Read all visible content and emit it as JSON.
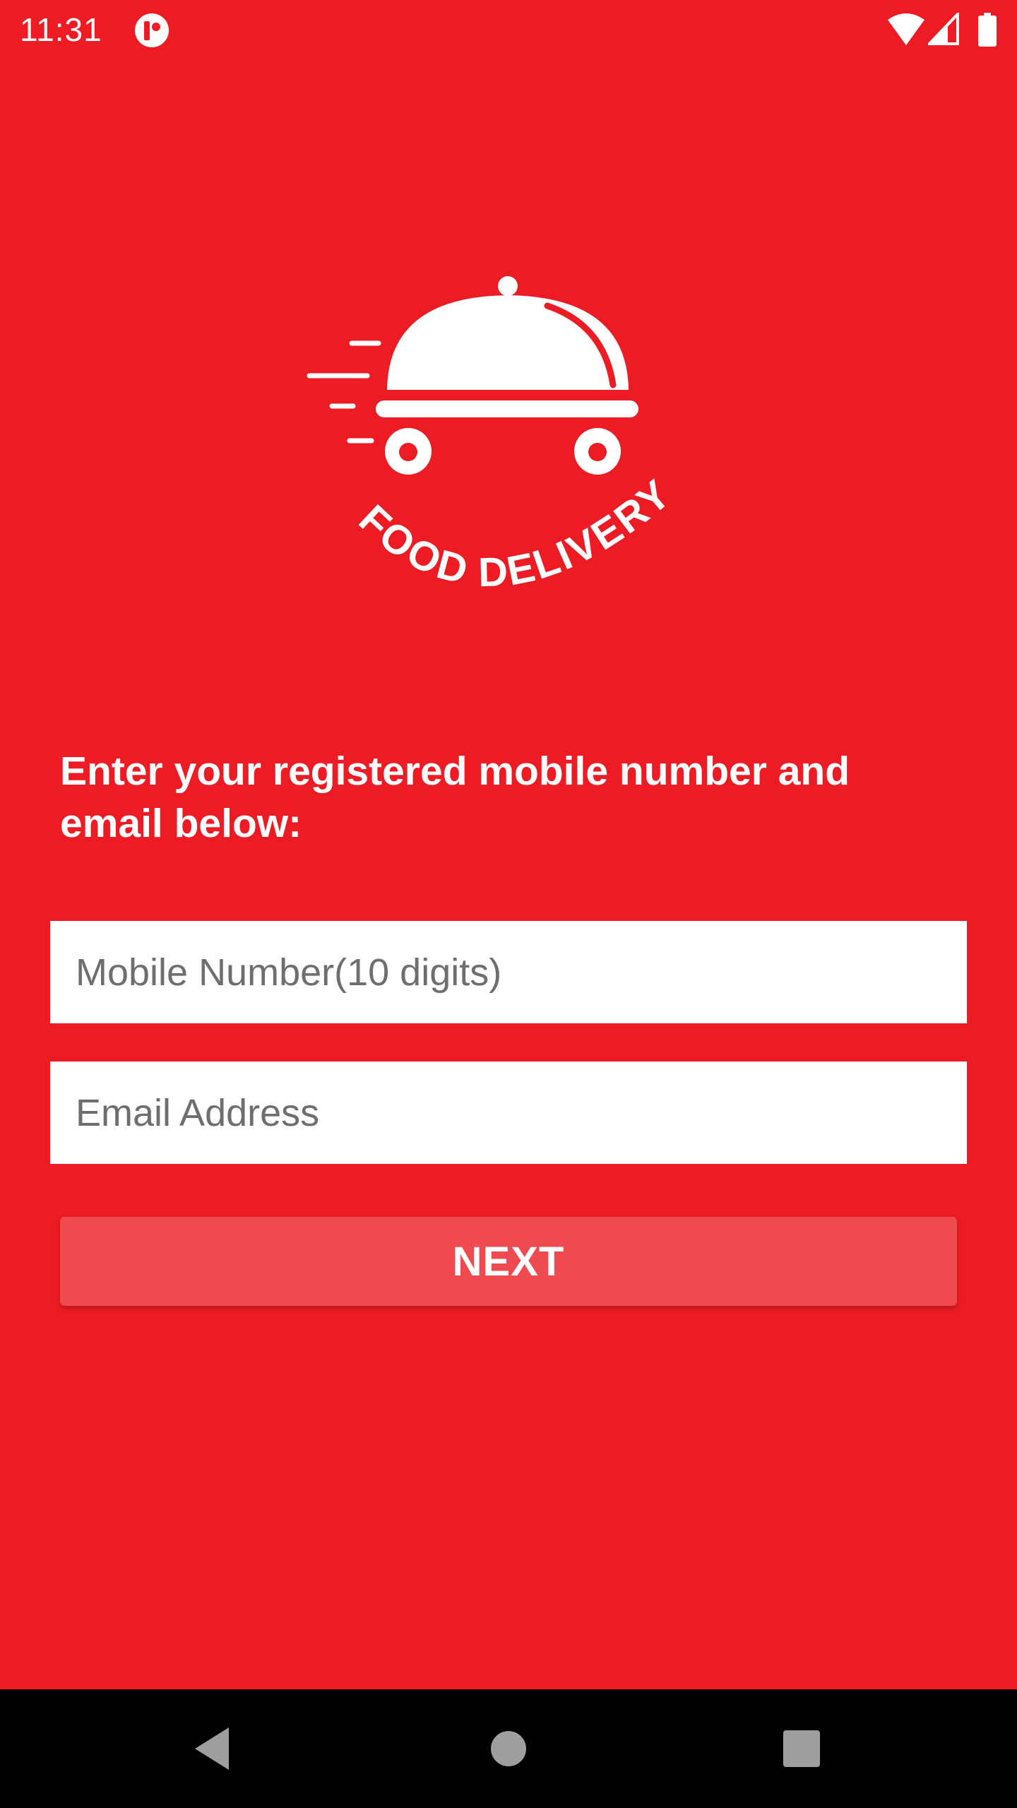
{
  "status_bar": {
    "time": "11:31",
    "app_icon": "notification-app-icon",
    "wifi_icon": "wifi-icon",
    "signal_icon": "cell-signal-icon",
    "battery_icon": "battery-icon"
  },
  "logo": {
    "icon": "food-cloche-cart-icon",
    "text": "FOOD DELIVERY"
  },
  "form": {
    "instruction": "Enter your registered mobile number and email below:",
    "mobile_placeholder": "Mobile Number(10 digits)",
    "mobile_value": "",
    "email_placeholder": "Email Address",
    "email_value": "",
    "next_label": "NEXT"
  },
  "nav_bar": {
    "back_icon": "back-triangle-icon",
    "home_icon": "home-circle-icon",
    "recents_icon": "recents-square-icon"
  },
  "colors": {
    "background": "#ed1c24",
    "button": "#ef4a50",
    "field": "#ffffff",
    "text_light": "#ffffff",
    "placeholder": "#6e6e6e",
    "nav_bar": "#000000"
  }
}
